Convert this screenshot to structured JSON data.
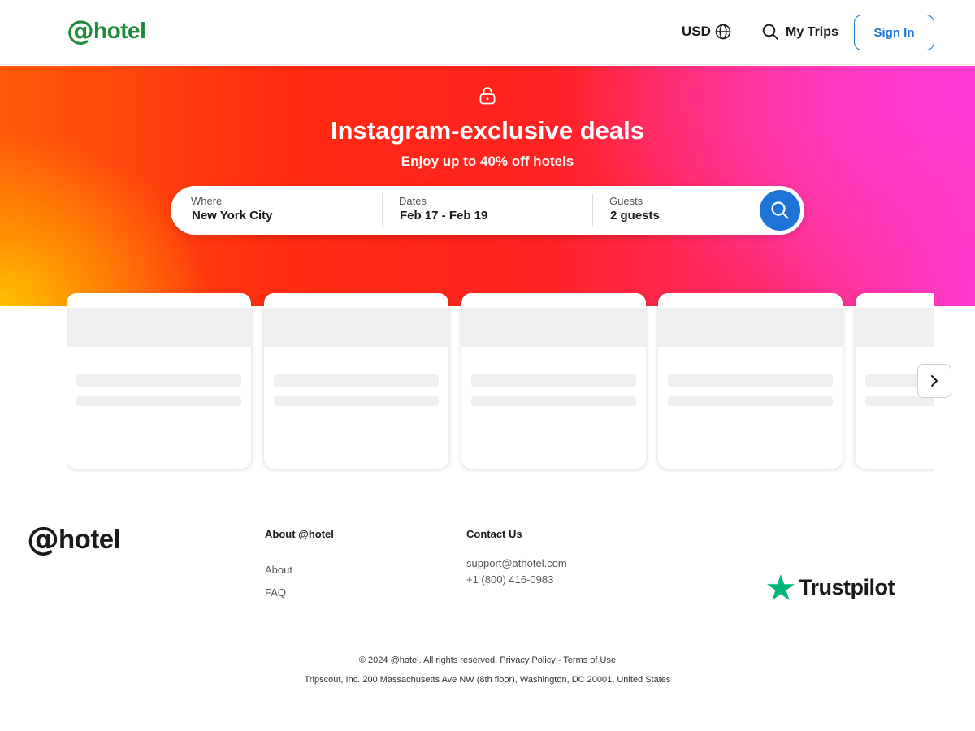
{
  "header": {
    "logo_at": "@",
    "logo_text": "hotel",
    "currency": "USD",
    "my_trips": "My Trips",
    "sign_in": "Sign In"
  },
  "hero": {
    "title": "Instagram-exclusive deals",
    "subtitle": "Enjoy up to 40% off hotels",
    "lock_icon": "unlocked-lock-icon"
  },
  "search": {
    "where_label": "Where",
    "where_value": "New York City",
    "dates_label": "Dates",
    "dates_value": "Feb 17 - Feb 19",
    "guests_label": "Guests",
    "guests_value": "2 guests",
    "button_icon": "search-icon"
  },
  "cards": {
    "count": 5,
    "state": "loading-placeholder"
  },
  "footer": {
    "logo_at": "@",
    "logo_text": "hotel",
    "about_heading": "About @hotel",
    "about_link": "About",
    "faq_link": "FAQ",
    "contact_heading": "Contact Us",
    "email": "support@athotel.com",
    "phone": "+1 (800) 416-0983",
    "trustpilot": "Trustpilot",
    "copyright": "© 2024 @hotel. All rights reserved.",
    "privacy": "Privacy Policy",
    "separator": "-",
    "terms": "Terms of Use",
    "address": "Tripscout, Inc. 200 Massachusetts Ave NW (8th floor), Washington, DC 20001, United States"
  },
  "colors": {
    "brand_green": "#1f8a3b",
    "accent_blue": "#1e73d9",
    "trustpilot_green": "#00b67a"
  }
}
